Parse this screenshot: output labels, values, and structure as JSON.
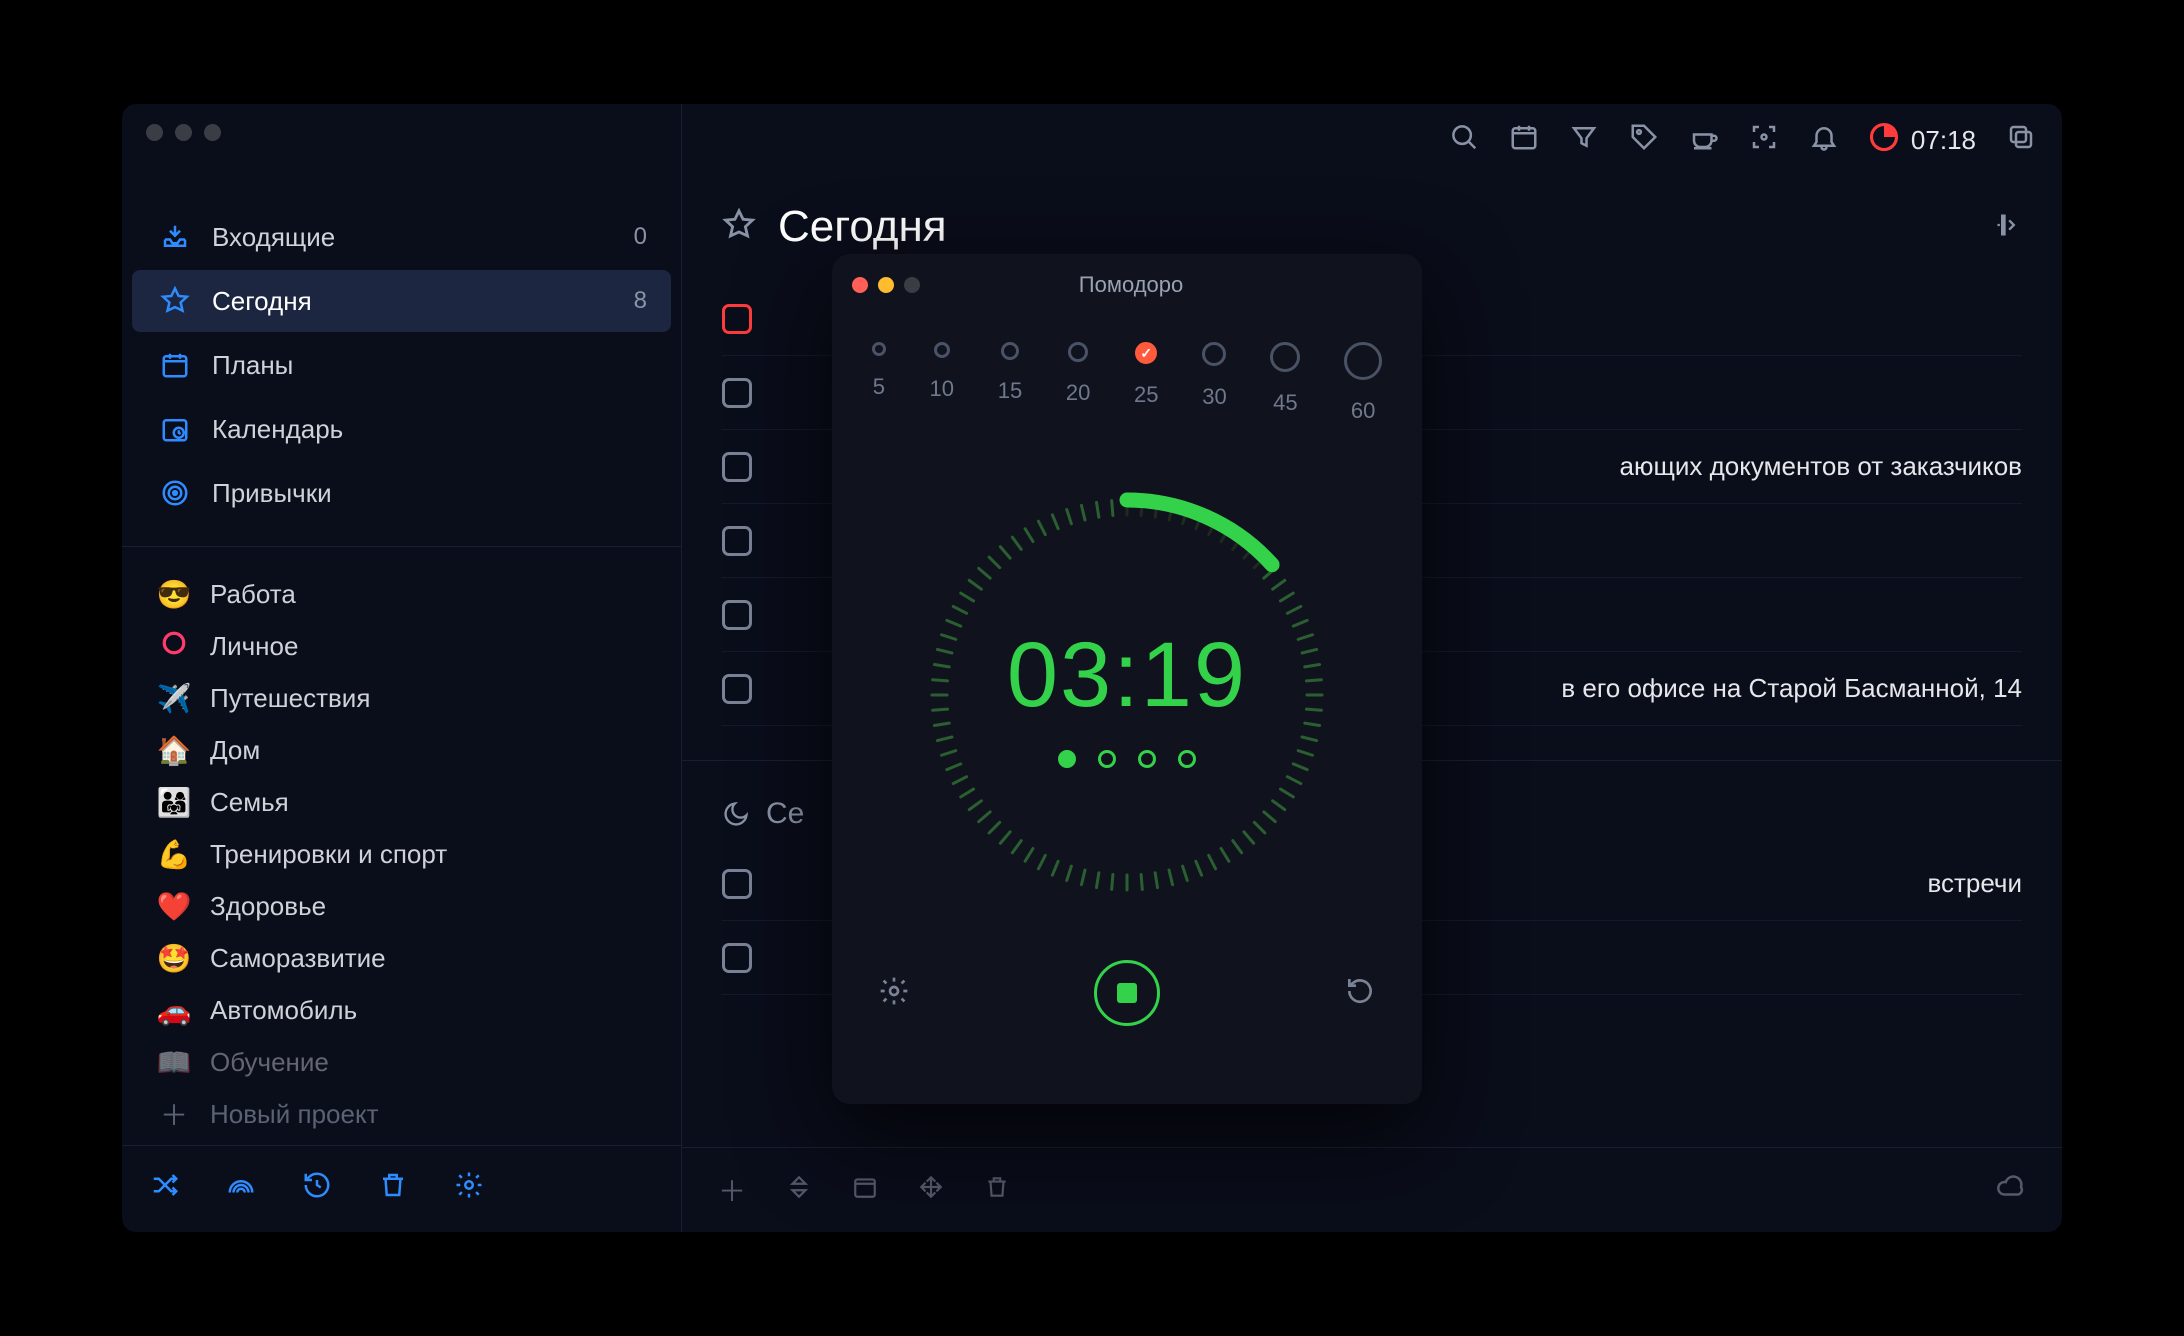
{
  "header": {
    "timer": "07:18"
  },
  "sidebar": {
    "smart": [
      {
        "icon": "inbox",
        "label": "Входящие",
        "count": "0"
      },
      {
        "icon": "star",
        "label": "Сегодня",
        "count": "8"
      },
      {
        "icon": "plans",
        "label": "Планы",
        "count": ""
      },
      {
        "icon": "cal",
        "label": "Календарь",
        "count": ""
      },
      {
        "icon": "target",
        "label": "Привычки",
        "count": ""
      }
    ],
    "projects": [
      {
        "emoji": "😎",
        "label": "Работа"
      },
      {
        "emoji": "⭕",
        "label": "Личное",
        "ring": true
      },
      {
        "emoji": "✈️",
        "label": "Путешествия"
      },
      {
        "emoji": "🏠",
        "label": "Дом"
      },
      {
        "emoji": "👨‍👩‍👧",
        "label": "Семья"
      },
      {
        "emoji": "💪",
        "label": "Тренировки и спорт"
      },
      {
        "emoji": "❤️",
        "label": "Здоровье"
      },
      {
        "emoji": "🤩",
        "label": "Саморазвитие"
      },
      {
        "emoji": "🚗",
        "label": "Автомобиль"
      },
      {
        "emoji": "📖",
        "label": "Обучение"
      }
    ],
    "new_project": "Новый проект"
  },
  "page": {
    "title": "Сегодня",
    "section_evening_prefix": "Се",
    "tasks_tail": [
      "ающих документов от заказчиков",
      "в его офисе на Старой Басманной, 14"
    ],
    "evening_tasks_tail": [
      "встречи",
      ""
    ]
  },
  "pomodoro": {
    "title": "Помодоро",
    "durations": [
      "5",
      "10",
      "15",
      "20",
      "25",
      "30",
      "45",
      "60"
    ],
    "active_index": 4,
    "time": "03:19",
    "cycles_total": 4,
    "cycles_done": 1
  }
}
